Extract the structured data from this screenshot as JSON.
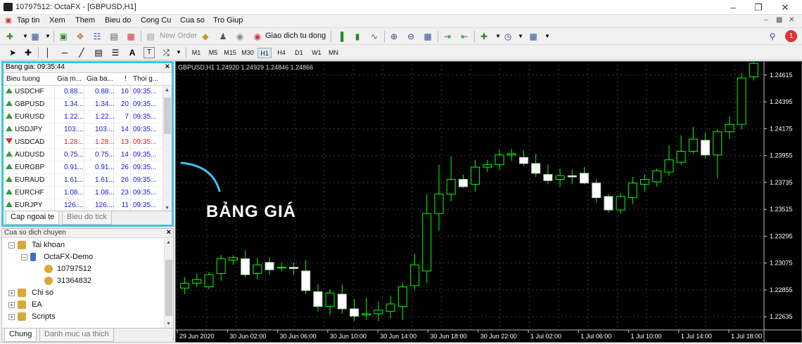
{
  "window": {
    "title": "10797512: OctaFX - [GBPUSD,H1]"
  },
  "menu": [
    "Tap tin",
    "Xem",
    "Them",
    "Bieu do",
    "Cong Cu",
    "Cua so",
    "Tro Giup"
  ],
  "toolbar": {
    "new_order": "New Order",
    "auto_trading": "Giao dich tu dong",
    "notifications_badge": "1"
  },
  "timeframes": [
    "M1",
    "M5",
    "M15",
    "M30",
    "H1",
    "H4",
    "D1",
    "W1",
    "MN"
  ],
  "active_timeframe": "H1",
  "market_watch": {
    "title": "Bang gia: 09:35:44",
    "columns": [
      "Bieu tuong",
      "Gia m...",
      "Gia ba...",
      "!",
      "Thoi g..."
    ],
    "rows": [
      {
        "symbol": "USDCHF",
        "bid": "0.88...",
        "ask": "0.88...",
        "spread": "16",
        "time": "09:35...",
        "dir": "up"
      },
      {
        "symbol": "GBPUSD",
        "bid": "1.34...",
        "ask": "1.34...",
        "spread": "20",
        "time": "09:35...",
        "dir": "up"
      },
      {
        "symbol": "EURUSD",
        "bid": "1.22...",
        "ask": "1.22...",
        "spread": "7",
        "time": "09:35...",
        "dir": "up"
      },
      {
        "symbol": "USDJPY",
        "bid": "103....",
        "ask": "103....",
        "spread": "14",
        "time": "09:35...",
        "dir": "up"
      },
      {
        "symbol": "USDCAD",
        "bid": "1.28...",
        "ask": "1.28...",
        "spread": "13",
        "time": "09:35...",
        "dir": "down"
      },
      {
        "symbol": "AUDUSD",
        "bid": "0.75...",
        "ask": "0.75...",
        "spread": "14",
        "time": "09:35...",
        "dir": "up"
      },
      {
        "symbol": "EURGBP",
        "bid": "0.91...",
        "ask": "0.91...",
        "spread": "26",
        "time": "09:35...",
        "dir": "up"
      },
      {
        "symbol": "EURAUD",
        "bid": "1.61...",
        "ask": "1.61...",
        "spread": "26",
        "time": "09:35...",
        "dir": "up"
      },
      {
        "symbol": "EURCHF",
        "bid": "1.08...",
        "ask": "1.08...",
        "spread": "23",
        "time": "09:35...",
        "dir": "up"
      },
      {
        "symbol": "EURJPY",
        "bid": "126....",
        "ask": "126....",
        "spread": "11",
        "time": "09:35...",
        "dir": "up"
      }
    ],
    "tabs": [
      "Cap ngoai te",
      "Bieu do tick"
    ],
    "active_tab": "Cap ngoai te",
    "colors": {
      "up": "#3a9a3a",
      "down": "#d83030",
      "value": "#1818d8",
      "highlight_border": "#38c6e5"
    }
  },
  "navigator": {
    "title": "Cua so dich chuyen",
    "tree": {
      "accounts_label": "Tai khoan",
      "server": "OctaFX-Demo",
      "accounts": [
        "10797512",
        "31364832"
      ],
      "indicators": "Chi so",
      "experts": "EA",
      "scripts": "Scripts"
    },
    "tabs": [
      "Chung",
      "Danh muc ua thich"
    ],
    "active_tab": "Chung"
  },
  "chart": {
    "header": "GBPUSD,H1  1.24920 1.24929 1.24846 1.24866",
    "price_labels": [
      "1.24615",
      "1.24395",
      "1.24175",
      "1.23955",
      "1.23735",
      "1.23515",
      "1.23295",
      "1.23075",
      "1.22855",
      "1.22635"
    ],
    "time_labels": [
      "29 Jun 2020",
      "30 Jun 02:00",
      "30 Jun 06:00",
      "30 Jun 10:00",
      "30 Jun 14:00",
      "30 Jun 18:00",
      "30 Jun 22:00",
      "1 Jul 02:00",
      "1 Jul 06:00",
      "1 Jul 10:00",
      "1 Jul 14:00",
      "1 Jul 18:00"
    ],
    "colors": {
      "bull_body": "#000000",
      "bull_border": "#00ff00",
      "bear_body": "#ffffff",
      "wick": "#00ff00",
      "grid": "#3a3a3a",
      "axis_text": "#ffffff"
    }
  },
  "chart_data": {
    "type": "candlestick",
    "symbol": "GBPUSD",
    "timeframe": "H1",
    "ylim": [
      1.2255,
      1.247
    ],
    "candles": [
      {
        "o": 1.2287,
        "h": 1.2296,
        "l": 1.2282,
        "c": 1.2291
      },
      {
        "o": 1.2291,
        "h": 1.2299,
        "l": 1.2288,
        "c": 1.2294
      },
      {
        "o": 1.2288,
        "h": 1.23,
        "l": 1.2286,
        "c": 1.2298
      },
      {
        "o": 1.2299,
        "h": 1.2314,
        "l": 1.2293,
        "c": 1.2311
      },
      {
        "o": 1.231,
        "h": 1.2314,
        "l": 1.2306,
        "c": 1.2312
      },
      {
        "o": 1.2311,
        "h": 1.2318,
        "l": 1.2296,
        "c": 1.2298
      },
      {
        "o": 1.2299,
        "h": 1.2312,
        "l": 1.2294,
        "c": 1.2306
      },
      {
        "o": 1.2308,
        "h": 1.2312,
        "l": 1.2298,
        "c": 1.2302
      },
      {
        "o": 1.2304,
        "h": 1.2308,
        "l": 1.2301,
        "c": 1.2304
      },
      {
        "o": 1.2304,
        "h": 1.2308,
        "l": 1.2298,
        "c": 1.2303
      },
      {
        "o": 1.2301,
        "h": 1.231,
        "l": 1.2282,
        "c": 1.2285
      },
      {
        "o": 1.2284,
        "h": 1.229,
        "l": 1.2268,
        "c": 1.2272
      },
      {
        "o": 1.2272,
        "h": 1.2286,
        "l": 1.2265,
        "c": 1.2283
      },
      {
        "o": 1.2282,
        "h": 1.229,
        "l": 1.2266,
        "c": 1.227
      },
      {
        "o": 1.227,
        "h": 1.2278,
        "l": 1.226,
        "c": 1.2264
      },
      {
        "o": 1.2265,
        "h": 1.2279,
        "l": 1.2261,
        "c": 1.2266
      },
      {
        "o": 1.2266,
        "h": 1.2276,
        "l": 1.226,
        "c": 1.2269
      },
      {
        "o": 1.2268,
        "h": 1.2281,
        "l": 1.2262,
        "c": 1.2274
      },
      {
        "o": 1.2272,
        "h": 1.2291,
        "l": 1.2261,
        "c": 1.2288
      },
      {
        "o": 1.2289,
        "h": 1.2315,
        "l": 1.2286,
        "c": 1.2306
      },
      {
        "o": 1.2301,
        "h": 1.2364,
        "l": 1.2291,
        "c": 1.2348
      },
      {
        "o": 1.2348,
        "h": 1.2388,
        "l": 1.2334,
        "c": 1.2364
      },
      {
        "o": 1.2364,
        "h": 1.2395,
        "l": 1.2358,
        "c": 1.2376
      },
      {
        "o": 1.2376,
        "h": 1.238,
        "l": 1.2369,
        "c": 1.237
      },
      {
        "o": 1.2372,
        "h": 1.2392,
        "l": 1.2366,
        "c": 1.2386
      },
      {
        "o": 1.2386,
        "h": 1.2392,
        "l": 1.2382,
        "c": 1.2388
      },
      {
        "o": 1.2388,
        "h": 1.24,
        "l": 1.2384,
        "c": 1.2396
      },
      {
        "o": 1.2396,
        "h": 1.2401,
        "l": 1.2391,
        "c": 1.2397
      },
      {
        "o": 1.2394,
        "h": 1.24,
        "l": 1.2387,
        "c": 1.2389
      },
      {
        "o": 1.2389,
        "h": 1.2397,
        "l": 1.2378,
        "c": 1.2381
      },
      {
        "o": 1.238,
        "h": 1.2388,
        "l": 1.2372,
        "c": 1.2375
      },
      {
        "o": 1.2376,
        "h": 1.2385,
        "l": 1.237,
        "c": 1.2379
      },
      {
        "o": 1.2379,
        "h": 1.2384,
        "l": 1.2372,
        "c": 1.2378
      },
      {
        "o": 1.2381,
        "h": 1.2386,
        "l": 1.2372,
        "c": 1.2373
      },
      {
        "o": 1.2373,
        "h": 1.2376,
        "l": 1.2357,
        "c": 1.2361
      },
      {
        "o": 1.2362,
        "h": 1.2364,
        "l": 1.2349,
        "c": 1.2351
      },
      {
        "o": 1.2351,
        "h": 1.2365,
        "l": 1.2348,
        "c": 1.2362
      },
      {
        "o": 1.2361,
        "h": 1.2378,
        "l": 1.2356,
        "c": 1.2373
      },
      {
        "o": 1.2372,
        "h": 1.238,
        "l": 1.2366,
        "c": 1.2376
      },
      {
        "o": 1.2374,
        "h": 1.2385,
        "l": 1.237,
        "c": 1.2383
      },
      {
        "o": 1.2382,
        "h": 1.2404,
        "l": 1.2379,
        "c": 1.2392
      },
      {
        "o": 1.239,
        "h": 1.2412,
        "l": 1.2388,
        "c": 1.2399
      },
      {
        "o": 1.2399,
        "h": 1.2419,
        "l": 1.2397,
        "c": 1.2409
      },
      {
        "o": 1.2408,
        "h": 1.2414,
        "l": 1.2393,
        "c": 1.2396
      },
      {
        "o": 1.2396,
        "h": 1.2417,
        "l": 1.2377,
        "c": 1.2415
      },
      {
        "o": 1.2415,
        "h": 1.2428,
        "l": 1.2409,
        "c": 1.2421
      },
      {
        "o": 1.2421,
        "h": 1.2463,
        "l": 1.2417,
        "c": 1.2459
      },
      {
        "o": 1.246,
        "h": 1.2474,
        "l": 1.2457,
        "c": 1.2471
      }
    ]
  }
}
